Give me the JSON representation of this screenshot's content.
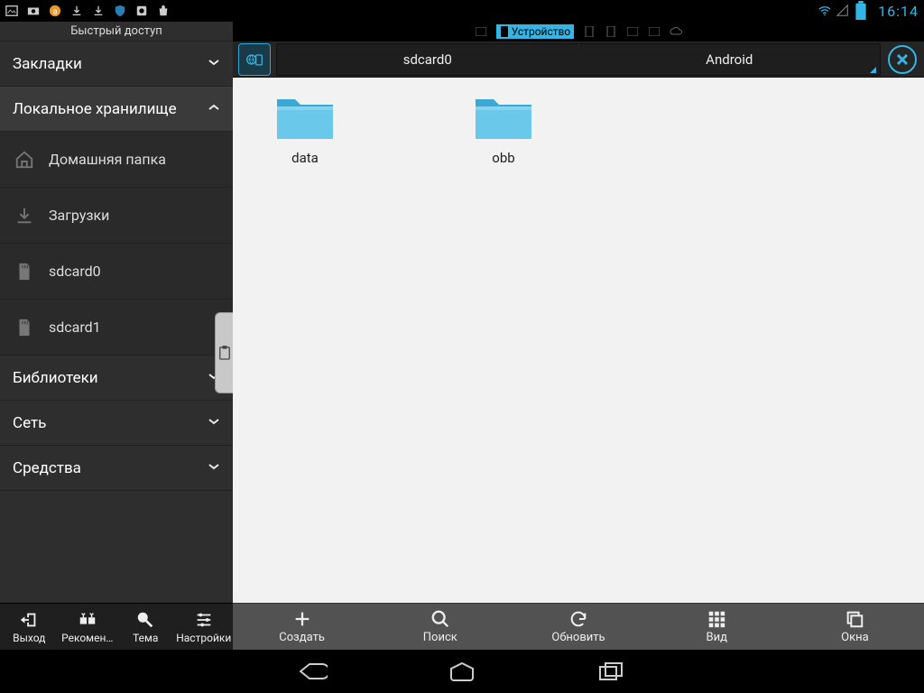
{
  "statusbar": {
    "clock": "16:14"
  },
  "sidebar": {
    "title": "Быстрый доступ",
    "sections": {
      "bookmarks": "Закладки",
      "local_storage": "Локальное хранилище",
      "libraries": "Библиотеки",
      "network": "Сеть",
      "tools": "Средства"
    },
    "items": {
      "home": "Домашняя папка",
      "downloads": "Загрузки",
      "sdcard0": "sdcard0",
      "sdcard1": "sdcard1"
    },
    "bottom": {
      "exit": "Выход",
      "recommend": "Рекомен…",
      "theme": "Тема",
      "settings": "Настройки"
    }
  },
  "tabs": {
    "active_label": "Устройство"
  },
  "breadcrumb": {
    "parent": "sdcard0",
    "current": "Android"
  },
  "folders": [
    {
      "name": "data"
    },
    {
      "name": "obb"
    }
  ],
  "actions": {
    "create": "Создать",
    "search": "Поиск",
    "refresh": "Обновить",
    "view": "Вид",
    "windows": "Окна"
  }
}
